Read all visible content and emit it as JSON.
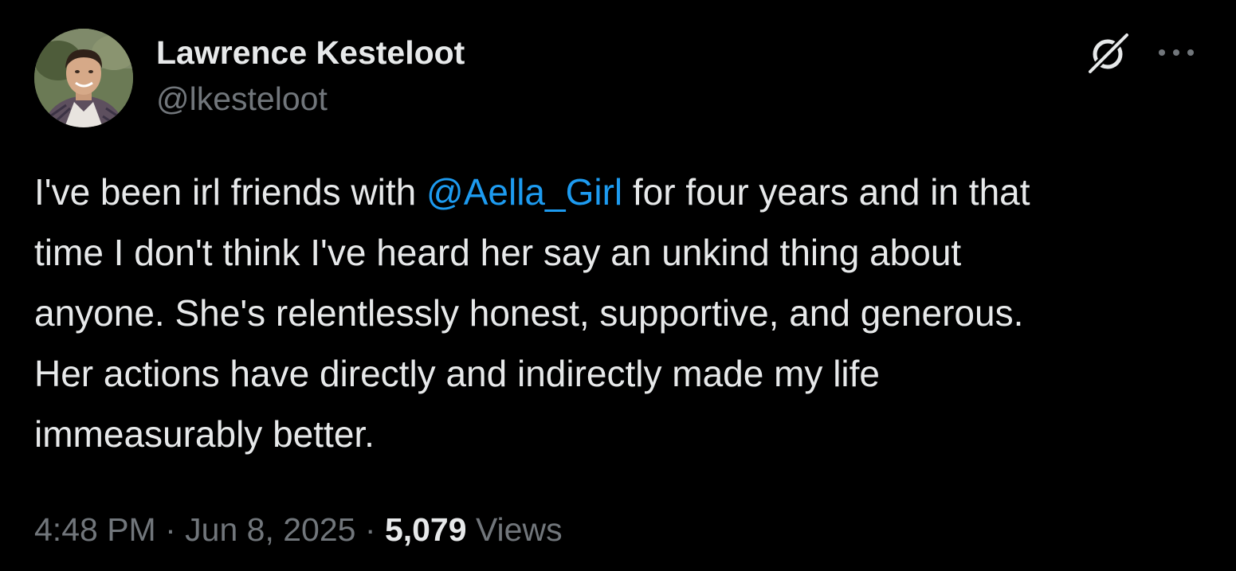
{
  "author": {
    "display_name": "Lawrence Kesteloot",
    "handle": "@lkesteloot",
    "avatar_icon": "profile-photo"
  },
  "header_actions": {
    "grok_icon": "grok-slash-icon",
    "more_icon": "more-horizontal-icon"
  },
  "tweet": {
    "lines": [
      {
        "before": "I've been irl friends with ",
        "mention": "@Aella_Girl",
        "after": " for four years and in that"
      },
      {
        "text": "time I don't think I've heard her say an unkind thing about"
      },
      {
        "text": "anyone. She's relentlessly honest, supportive, and generous."
      },
      {
        "text": "Her actions have directly and indirectly made my life"
      },
      {
        "text": "immeasurably better."
      }
    ]
  },
  "meta": {
    "time": "4:48 PM",
    "separator": "·",
    "date": "Jun 8, 2025",
    "views_count": "5,079",
    "views_label": "Views"
  },
  "colors": {
    "background": "#000000",
    "text_primary": "#e7e9ea",
    "text_secondary": "#71767b",
    "link": "#1d9bf0"
  }
}
